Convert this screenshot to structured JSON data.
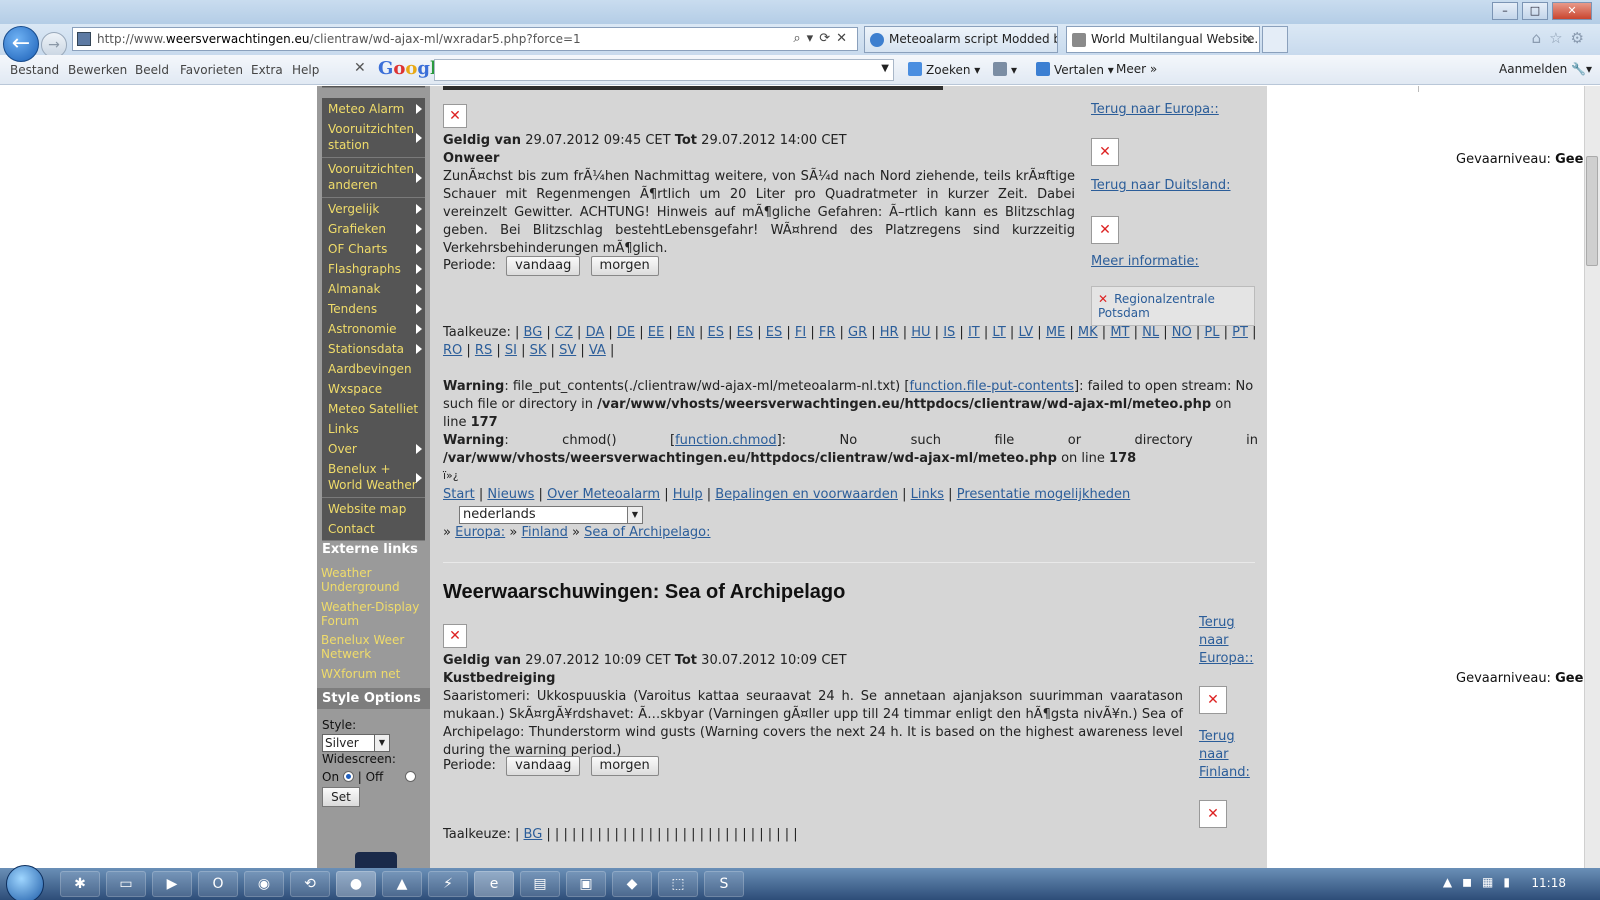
{
  "browser": {
    "url_prefix": "http://www.",
    "url_domain": "weersverwachtingen.eu",
    "url_path": "/clientraw/wd-ajax-ml/wxradar5.php?force=1",
    "tabs": [
      {
        "label": "Meteoalarm script Modded by ...",
        "active": false
      },
      {
        "label": "World Multilangual Website...",
        "active": true
      }
    ],
    "menu": [
      "Bestand",
      "Bewerken",
      "Beeld",
      "Favorieten",
      "Extra",
      "Help"
    ],
    "google_label": "Google",
    "toolbar": {
      "zoeken": "Zoeken",
      "vertalen": "Vertalen",
      "meer": "Meer",
      "aanmelden": "Aanmelden"
    }
  },
  "sidebar": {
    "items": [
      {
        "label": "Meteo Alarm",
        "arrow": true
      },
      {
        "label": "Vooruitzichten station",
        "arrow": true
      },
      {
        "label": "Vooruitzichten anderen",
        "arrow": true
      },
      {
        "label": "Vergelijk",
        "arrow": true
      },
      {
        "label": "Grafieken",
        "arrow": true
      },
      {
        "label": "OF Charts",
        "arrow": true
      },
      {
        "label": "Flashgraphs",
        "arrow": true
      },
      {
        "label": "Almanak",
        "arrow": true
      },
      {
        "label": "Tendens",
        "arrow": true
      },
      {
        "label": "Astronomie",
        "arrow": true
      },
      {
        "label": "Stationsdata",
        "arrow": true
      },
      {
        "label": "Aardbevingen",
        "arrow": false
      },
      {
        "label": "Wxspace",
        "arrow": false
      },
      {
        "label": "Meteo Satelliet",
        "arrow": false
      },
      {
        "label": "Links",
        "arrow": false
      },
      {
        "label": "Over",
        "arrow": true
      },
      {
        "label": "Benelux + World Weather",
        "arrow": true
      },
      {
        "label": "Website map",
        "arrow": false
      },
      {
        "label": "Contact",
        "arrow": false
      }
    ],
    "external_heading": "Externe links",
    "external_links": [
      "Weather Underground",
      "Weather-Display Forum",
      "Benelux Weer Netwerk",
      "WXforum net"
    ],
    "style_heading": "Style Options",
    "style_label": "Style:",
    "style_value": "Silver",
    "widescreen_label": "Widescreen:",
    "on_label": "On",
    "off_label": "| Off",
    "set_button": "Set"
  },
  "section1": {
    "valid_prefix": "Geldig van",
    "valid_from": "29.07.2012 09:45 CET",
    "tot": "Tot",
    "valid_to": "29.07.2012 14:00 CET",
    "type": "Onweer",
    "description": "ZunÃ¤chst bis zum frÃ¼hen Nachmittag weitere, von SÃ¼d nach Nord ziehende, teils krÃ¤ftige Schauer mit Regenmengen Ã¶rtlich um 20 Liter pro Quadratmeter in kurzer Zeit. Dabei vereinzelt Gewitter. ACHTUNG! Hinweis auf mÃ¶gliche Gefahren: Ã–rtlich kann es Blitzschlag geben. Bei Blitzschlag bestehtLebensgefahr! WÃ¤hrend des Platzregens sind kurzzeitig Verkehrsbehinderungen mÃ¶glich.",
    "periode_label": "Periode:",
    "btn_today": "vandaag",
    "btn_tomorrow": "morgen",
    "taalkeuze_label": "Taalkeuze:",
    "languages": [
      "BG",
      "CZ",
      "DA",
      "DE",
      "EE",
      "EN",
      "ES",
      "ES",
      "ES",
      "FI",
      "FR",
      "GR",
      "HR",
      "HU",
      "IS",
      "IT",
      "LT",
      "LV",
      "ME",
      "MK",
      "MT",
      "NL",
      "NO",
      "PL",
      "PT",
      "RO",
      "RS",
      "SI",
      "SK",
      "SV",
      "VA"
    ],
    "right_links": {
      "europa": "Terug naar Europa::",
      "country": "Terug naar Duitsland:",
      "meer": "Meer informatie:",
      "regional": "Regionalzentrale Potsdam"
    },
    "gevaarniveau_label": "Gevaarniveau:",
    "gevaarniveau_value": "Geel"
  },
  "warnings": [
    {
      "label": "Warning",
      "text1": ": file_put_contents(./clientraw/wd-ajax-ml/meteoalarm-nl.txt) [",
      "link": "function.file-put-contents",
      "text2": "]: failed to open stream: No such file or directory in ",
      "path": "/var/www/vhosts/weersverwachtingen.eu/httpdocs/clientraw/wd-ajax-ml/meteo.php",
      "online": " on line ",
      "line": "177"
    },
    {
      "label": "Warning",
      "text1": ": chmod() [",
      "link": "function.chmod",
      "text2": "]: No such file or directory in ",
      "path": "/var/www/vhosts/weersverwachtingen.eu/httpdocs/clientraw/wd-ajax-ml/meteo.php",
      "online": " on line ",
      "line": "178"
    }
  ],
  "bom": "ï»¿",
  "footer_nav": [
    "Start",
    "Nieuws",
    "Over Meteoalarm",
    "Hulp",
    "Bepalingen en voorwaarden",
    "Links",
    "Presentatie mogelijkheden"
  ],
  "language_select": "nederlands",
  "breadcrumb": {
    "sep": "»",
    "europa": "Europa:",
    "finland": "Finland",
    "sea": "Sea of Archipelago:"
  },
  "section2": {
    "title": "Weerwaarschuwingen: Sea of Archipelago",
    "valid_prefix": "Geldig van",
    "valid_from": "29.07.2012 10:09 CET",
    "tot": "Tot",
    "valid_to": "30.07.2012 10:09 CET",
    "type": "Kustbedreiging",
    "description": "Saaristomeri: Ukkospuuskia (Varoitus kattaa seuraavat 24 h. Se annetaan ajanjakson suurimman vaaratason mukaan.) SkÃ¤rgÃ¥rdshavet: Ã…skbyar (Varningen gÃ¤ller upp till 24 timmar enligt den hÃ¶gsta nivÃ¥n.) Sea of Archipelago: Thunderstorm wind gusts (Warning covers the next 24 h. It is based on the highest awareness level during the warning period.)",
    "periode_label": "Periode:",
    "btn_today": "vandaag",
    "btn_tomorrow": "morgen",
    "taalkeuze_label": "Taalkeuze:",
    "first_lang": "BG",
    "right_links": {
      "europa": "Terug naar Europa::",
      "country": "Terug naar Finland:"
    },
    "gevaarniveau_label": "Gevaarniveau:",
    "gevaarniveau_value": "Geel"
  },
  "taskbar": {
    "clock": "11:18"
  }
}
